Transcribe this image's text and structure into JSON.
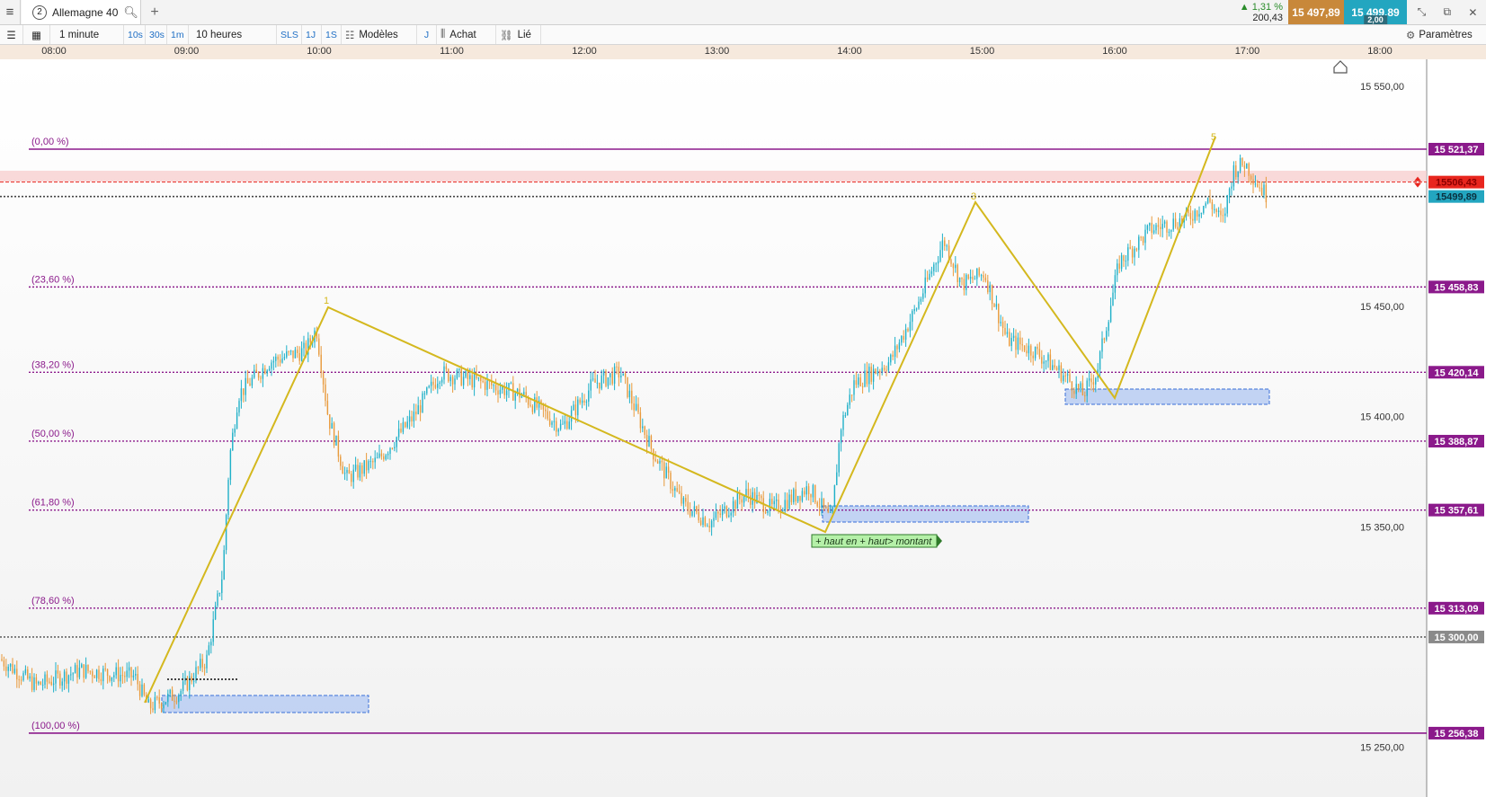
{
  "topbar": {
    "tab_number": "2",
    "instrument": "Allemagne 40",
    "change_pct": "▲ 1,31 %",
    "change_pts": "200,43",
    "bid": "15 497,89",
    "ask": "15 499,89",
    "spread": "2,00"
  },
  "toolbar": {
    "interval": "1 minute",
    "tf_10s": "10s",
    "tf_30s": "30s",
    "tf_1m": "1m",
    "period": "10 heures",
    "sls": "SLS",
    "tf_1j": "1J",
    "tf_1s": "1S",
    "models": "Modèles",
    "j": "J",
    "buy": "Achat",
    "linked": "Lié",
    "settings": "Paramètres"
  },
  "time_axis": [
    "08:00",
    "09:00",
    "10:00",
    "11:00",
    "12:00",
    "13:00",
    "14:00",
    "15:00",
    "16:00",
    "17:00",
    "18:00"
  ],
  "price_axis": [
    "15 550,00",
    "15 450,00",
    "15 400,00",
    "15 350,00",
    "15 250,00"
  ],
  "fib_levels": [
    {
      "label": "(0,00 %)",
      "price": 15521.37,
      "tag": "15 521,37"
    },
    {
      "label": "(23,60 %)",
      "price": 15458.83,
      "tag": "15 458,83"
    },
    {
      "label": "(38,20 %)",
      "price": 15420.14,
      "tag": "15 420,14"
    },
    {
      "label": "(50,00 %)",
      "price": 15388.87,
      "tag": "15 388,87"
    },
    {
      "label": "(61,80 %)",
      "price": 15357.61,
      "tag": "15 357,61"
    },
    {
      "label": "(78,60 %)",
      "price": 15313.09,
      "tag": "15 313,09"
    },
    {
      "label": "(100,00 %)",
      "price": 15256.38,
      "tag": "15 256,38"
    }
  ],
  "levels": {
    "alert_price": "15506,43",
    "current_price": "15499,89",
    "gray_level": "15 300,00"
  },
  "wave_labels": [
    "1",
    "3",
    "5"
  ],
  "annotation": "+ haut en + haut> montant",
  "colors": {
    "fib": "#8b1a8b",
    "wave": "#d4b81e",
    "candle_up": "#1fb0c8",
    "candle_down": "#e89a3c",
    "alert": "#e8261e",
    "current": "#23a6c0",
    "zone": "#b9cdf2"
  }
}
